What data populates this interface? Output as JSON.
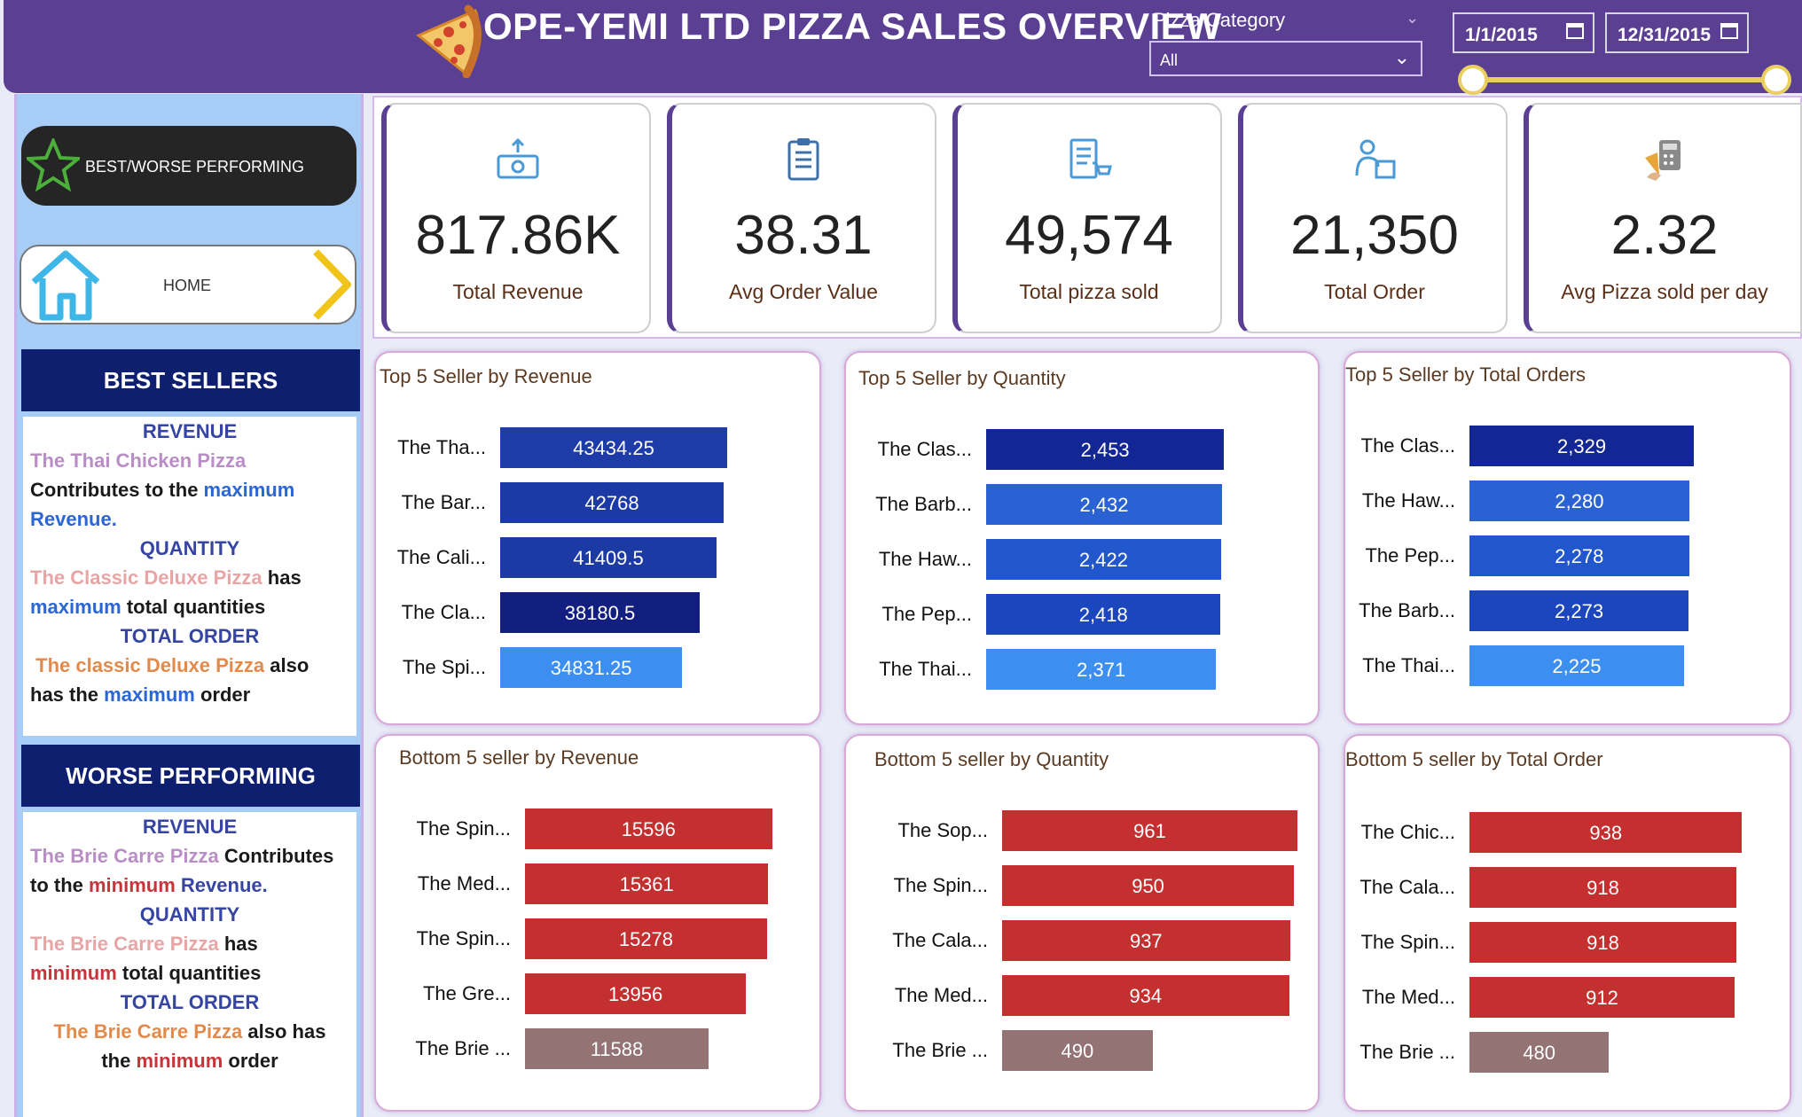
{
  "header": {
    "title": "OPE-YEMI LTD PIZZA SALES OVERVIEW",
    "category_label": "Pizza Category",
    "category_value": "All",
    "date_start": "1/1/2015",
    "date_end": "12/31/2015"
  },
  "sidebar": {
    "best_worse_button": "BEST/WORSE PERFORMING",
    "home_button": "HOME",
    "best_header": "BEST SELLERS",
    "best": {
      "rev_head": "REVENUE",
      "rev_pizza": "The Thai Chicken Pizza",
      "rev_t1": "Contributes to the ",
      "rev_t2": "maximum",
      "rev_t3": "Revenue.",
      "qty_head": "QUANTITY",
      "qty_pizza": "The Classic Deluxe Pizza",
      "qty_t1": " has",
      "qty_t2": "maximum",
      "qty_t3": " total quantities",
      "ord_head": "TOTAL ORDER",
      "ord_pizza": "The classic Deluxe Pizza",
      "ord_t1": " also",
      "ord_t2": "has the ",
      "ord_t3": "maximum",
      "ord_t4": " order"
    },
    "worse_header": "WORSE PERFORMING",
    "worse": {
      "rev_head": "REVENUE",
      "rev_pizza": "The Brie Carre Pizza",
      "rev_t1": " Contributes",
      "rev_t2": "to the ",
      "rev_t3": "minimum",
      "rev_t4": " Revenue.",
      "qty_head": "QUANTITY",
      "qty_pizza": "The Brie Carre Pizza",
      "qty_t1": " has",
      "qty_t2": "minimum",
      "qty_t3": " total quantities",
      "ord_head": "TOTAL ORDER",
      "ord_pizza": "The Brie Carre Pizza",
      "ord_t1": " also has",
      "ord_t2": "the ",
      "ord_t3": "minimum",
      "ord_t4": " order"
    }
  },
  "kpis": [
    {
      "value": "817.86K",
      "label": "Total Revenue",
      "icon": "money-icon"
    },
    {
      "value": "38.31",
      "label": "Avg Order Value",
      "icon": "clipboard-icon"
    },
    {
      "value": "49,574",
      "label": "Total pizza sold",
      "icon": "cart-list-icon"
    },
    {
      "value": "21,350",
      "label": "Total Order",
      "icon": "delivery-icon"
    },
    {
      "value": "2.32",
      "label": "Avg Pizza sold per day",
      "icon": "calculator-icon"
    }
  ],
  "colors": {
    "header": "#5a3f93",
    "sidebar": "#a7cdf7",
    "section_header": "#0f1f70",
    "bar_red": "#c42f2f",
    "bar_mauve": "#937373"
  },
  "chart_data": [
    {
      "type": "bar",
      "orientation": "horizontal",
      "title": "Top 5 Seller by Revenue",
      "categories": [
        "The Tha...",
        "The Bar...",
        "The Cali...",
        "The Cla...",
        "The Spi..."
      ],
      "values": [
        43434.25,
        42768,
        41409.5,
        38180.5,
        34831.25
      ],
      "value_labels": [
        "43434.25",
        "42768",
        "41409.5",
        "38180.5",
        "34831.25"
      ],
      "colors": [
        "#1e3ca8",
        "#1c3aa6",
        "#1b3aa4",
        "#131f80",
        "#3c8ff0"
      ],
      "xlim": [
        0,
        56000
      ]
    },
    {
      "type": "bar",
      "orientation": "horizontal",
      "title": "Top 5 Seller by Quantity",
      "categories": [
        "The Clas...",
        "The Barb...",
        "The Haw...",
        "The Pep...",
        "The Thai..."
      ],
      "values": [
        2453,
        2432,
        2422,
        2418,
        2371
      ],
      "value_labels": [
        "2,453",
        "2,432",
        "2,422",
        "2,418",
        "2,371"
      ],
      "colors": [
        "#132794",
        "#2a62d4",
        "#2256cc",
        "#1c46bd",
        "#3c8ff0"
      ],
      "xlim": [
        0,
        3200
      ]
    },
    {
      "type": "bar",
      "orientation": "horizontal",
      "title": "Top 5 Seller by Total Orders",
      "categories": [
        "The Clas...",
        "The Haw...",
        "The Pep...",
        "The Barb...",
        "The Thai..."
      ],
      "values": [
        2329,
        2280,
        2278,
        2273,
        2225
      ],
      "value_labels": [
        "2,329",
        "2,280",
        "2,278",
        "2,273",
        "2,225"
      ],
      "colors": [
        "#132794",
        "#2a62d4",
        "#2256cc",
        "#1c46bd",
        "#3c8ff0"
      ],
      "xlim": [
        0,
        3100
      ]
    },
    {
      "type": "bar",
      "orientation": "horizontal",
      "title": "Bottom 5 seller by Revenue",
      "categories": [
        "The Spin...",
        "The Med...",
        "The Spin...",
        "The Gre...",
        "The Brie ..."
      ],
      "values": [
        15596,
        15361,
        15278,
        13956,
        11588
      ],
      "value_labels": [
        "15596",
        "15361",
        "15278",
        "13956",
        "11588"
      ],
      "colors": [
        "#c42f2f",
        "#c42f2f",
        "#c42f2f",
        "#c42f2f",
        "#937373"
      ],
      "xlim": [
        0,
        17300
      ]
    },
    {
      "type": "bar",
      "orientation": "horizontal",
      "title": "Bottom 5 seller by Quantity",
      "categories": [
        "The Sop...",
        "The Spin...",
        "The Cala...",
        "The Med...",
        "The Brie ..."
      ],
      "values": [
        961,
        950,
        937,
        934,
        490
      ],
      "value_labels": [
        "961",
        "950",
        "937",
        "934",
        "490"
      ],
      "colors": [
        "#c42f2f",
        "#c42f2f",
        "#c42f2f",
        "#c42f2f",
        "#937373"
      ],
      "xlim": [
        0,
        964
      ]
    },
    {
      "type": "bar",
      "orientation": "horizontal",
      "title": "Bottom 5 seller by Total Order",
      "categories": [
        "The Chic...",
        "The Cala...",
        "The Spin...",
        "The Med...",
        "The Brie ..."
      ],
      "values": [
        938,
        918,
        918,
        912,
        480
      ],
      "value_labels": [
        "938",
        "918",
        "918",
        "912",
        "480"
      ],
      "colors": [
        "#c42f2f",
        "#c42f2f",
        "#c42f2f",
        "#c42f2f",
        "#937373"
      ],
      "xlim": [
        0,
        1025
      ]
    }
  ]
}
